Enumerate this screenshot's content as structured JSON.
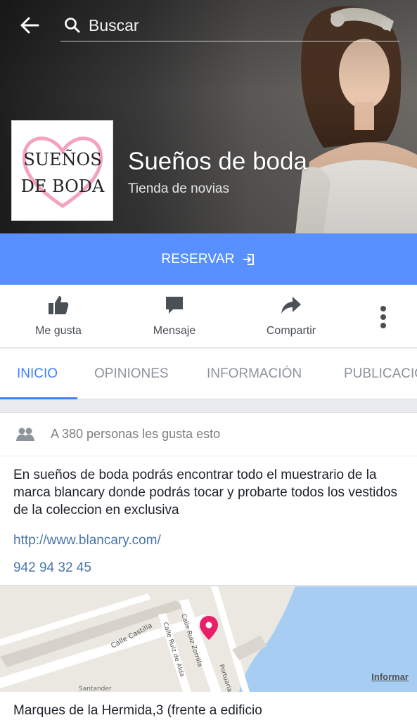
{
  "header": {
    "search_placeholder": "Buscar"
  },
  "page": {
    "name": "Sueños de boda",
    "category": "Tienda de novias",
    "logo_text_line1": "SUEÑOS",
    "logo_text_line2": "DE BODA"
  },
  "cta": {
    "label": "RESERVAR"
  },
  "actions": {
    "like": "Me gusta",
    "message": "Mensaje",
    "share": "Compartir"
  },
  "tabs": [
    {
      "label": "INICIO",
      "active": true
    },
    {
      "label": "OPINIONES",
      "active": false
    },
    {
      "label": "INFORMACIÓN",
      "active": false
    },
    {
      "label": "PUBLICACIONES",
      "active": false
    }
  ],
  "about": {
    "likes": "A 380 personas les gusta esto",
    "description": "En sueños de boda podrás encontrar todo el muestrario de la marca blancary donde podrás tocar y probarte todos los vestidos de la coleccion en exclusiva",
    "website": "http://www.blancary.com/",
    "phone": "942 94 32 45"
  },
  "map": {
    "street_1": "Calle Castilla",
    "street_2": "Calle Ruiz Zorrilla",
    "street_3": "Calle Ruiz de Alda",
    "street_4": "Portuaria",
    "street_5": "Santander",
    "report_label": "Informar"
  },
  "address": {
    "text": "Marques de la Hermida,3 (frente a edificio"
  },
  "colors": {
    "accent": "#5890ff",
    "tab_active": "#4080ff",
    "link": "#4a76a8",
    "map_pin": "#e8206a",
    "water": "#a7cdf2"
  },
  "icons": [
    "back-arrow-icon",
    "search-icon",
    "enter-icon",
    "thumbs-up-icon",
    "message-icon",
    "share-icon",
    "more-vertical-icon",
    "people-icon",
    "map-pin-icon"
  ]
}
